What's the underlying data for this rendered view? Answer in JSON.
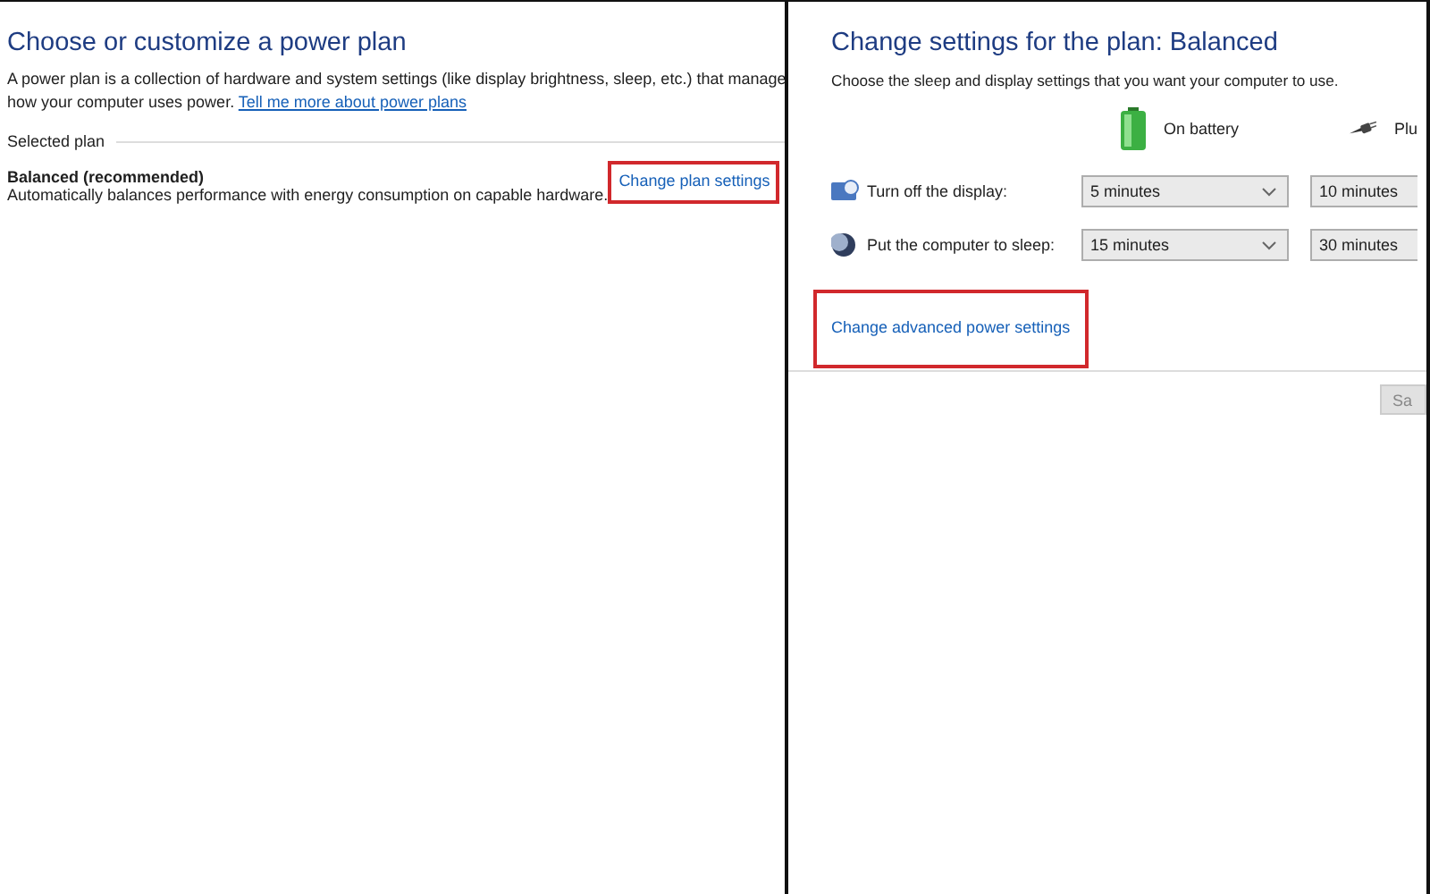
{
  "plan_list": {
    "title": "Choose or customize a power plan",
    "description": "A power plan is a collection of hardware and system settings (like display brightness, sleep, etc.) that manage how your computer uses power.",
    "more_link": "Tell me more about power plans",
    "section_label": "Selected plan",
    "plan": {
      "name": "Balanced (recommended)",
      "description": "Automatically balances performance with energy consumption on capable hardware.",
      "link": "Change plan settings",
      "highlighted": true
    }
  },
  "plan_settings": {
    "title": "Change settings for the plan: Balanced",
    "description": "Choose the sleep and display settings that you want your computer to use.",
    "columns": [
      {
        "kind": "battery",
        "label": "On battery"
      },
      {
        "kind": "plug",
        "label": "Plu"
      }
    ],
    "rows": [
      {
        "kind": "display",
        "label": "Turn off the display:",
        "values": [
          "5 minutes",
          "10 minutes"
        ]
      },
      {
        "kind": "sleep",
        "label": "Put the computer to sleep:",
        "values": [
          "15 minutes",
          "30 minutes"
        ]
      }
    ],
    "advanced_link": {
      "label": "Change advanced power settings",
      "highlighted": true
    },
    "save_button": "Sa"
  }
}
